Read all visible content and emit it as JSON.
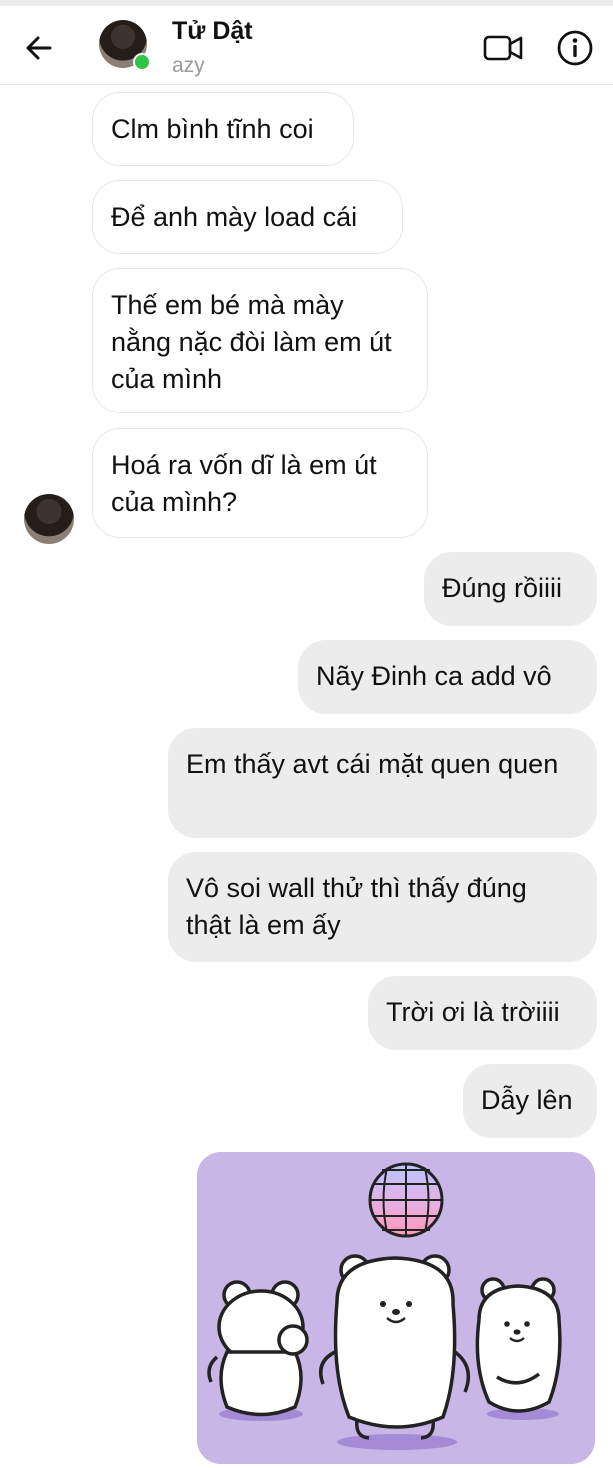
{
  "header": {
    "back_icon": "arrow-left-icon",
    "contact_name": "Tử Dật",
    "contact_sub": "azy",
    "online_color": "#31c24a",
    "video_icon": "video-camera-icon",
    "info_icon": "info-circle-icon"
  },
  "messages": [
    {
      "side": "incoming",
      "text": "Clm bình tĩnh coi"
    },
    {
      "side": "incoming",
      "text": "Để anh mày load cái"
    },
    {
      "side": "incoming",
      "text": "Thế em bé mà mày nằng nặc đòi làm em út của mình"
    },
    {
      "side": "incoming",
      "text": "Hoá ra vốn dĩ là em út của mình?"
    },
    {
      "side": "outgoing",
      "text": "Đúng rồiiii"
    },
    {
      "side": "outgoing",
      "text": "Nãy Đinh ca add vô"
    },
    {
      "side": "outgoing",
      "text": "Em thấy avt cái mặt quen quen"
    },
    {
      "side": "outgoing",
      "text": "Vô soi wall thử thì thấy đúng thật là em ấy"
    },
    {
      "side": "outgoing",
      "text": "Trời ơi là trờiiii"
    },
    {
      "side": "outgoing",
      "text": "Dẫy lên"
    }
  ],
  "sticker": {
    "description_icon": "dancing-bears-disco-ball-sticker",
    "background_color": "#c8b6e6"
  },
  "colors": {
    "incoming_bubble": "#ffffff",
    "outgoing_bubble": "#ececec"
  }
}
